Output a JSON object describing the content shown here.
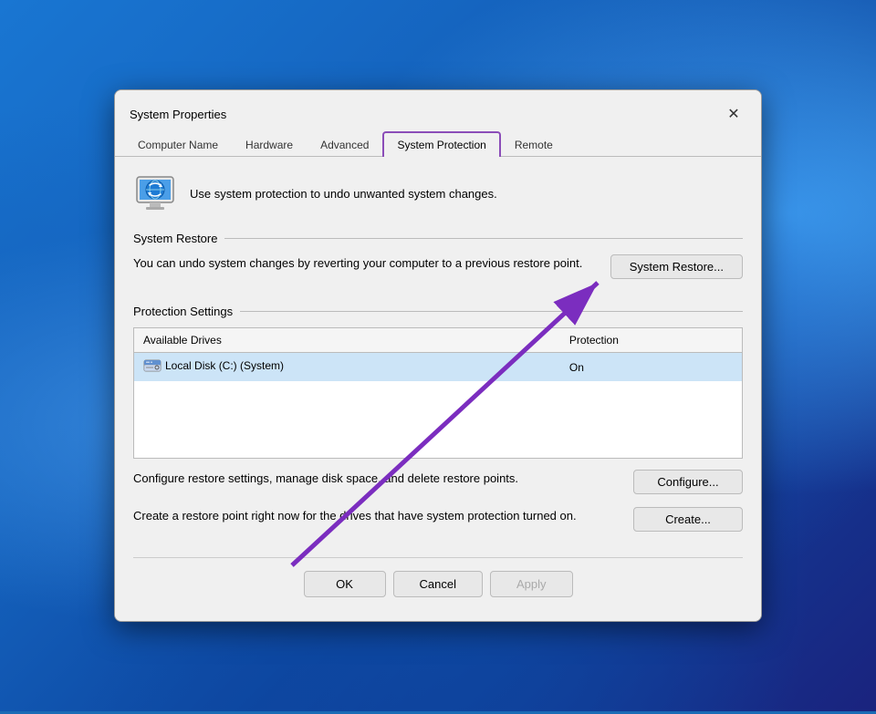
{
  "background": {
    "style": "windows11-blue"
  },
  "dialog": {
    "title": "System Properties",
    "close_label": "✕",
    "tabs": [
      {
        "id": "computer-name",
        "label": "Computer Name",
        "active": false
      },
      {
        "id": "hardware",
        "label": "Hardware",
        "active": false
      },
      {
        "id": "advanced",
        "label": "Advanced",
        "active": false
      },
      {
        "id": "system-protection",
        "label": "System Protection",
        "active": true
      },
      {
        "id": "remote",
        "label": "Remote",
        "active": false
      }
    ],
    "header": {
      "text": "Use system protection to undo unwanted system changes."
    },
    "system_restore_section": {
      "title": "System Restore",
      "description": "You can undo system changes by reverting\nyour computer to a previous restore point.",
      "button_label": "System Restore..."
    },
    "protection_settings_section": {
      "title": "Protection Settings",
      "table": {
        "columns": [
          "Available Drives",
          "Protection"
        ],
        "rows": [
          {
            "drive": "Local Disk (C:) (System)",
            "protection": "On",
            "selected": true
          }
        ]
      },
      "configure_text": "Configure restore settings, manage disk space, and\ndelete restore points.",
      "configure_button": "Configure...",
      "create_text": "Create a restore point right now for the drives that\nhave system protection turned on.",
      "create_button": "Create..."
    },
    "footer": {
      "ok_label": "OK",
      "cancel_label": "Cancel",
      "apply_label": "Apply"
    }
  }
}
